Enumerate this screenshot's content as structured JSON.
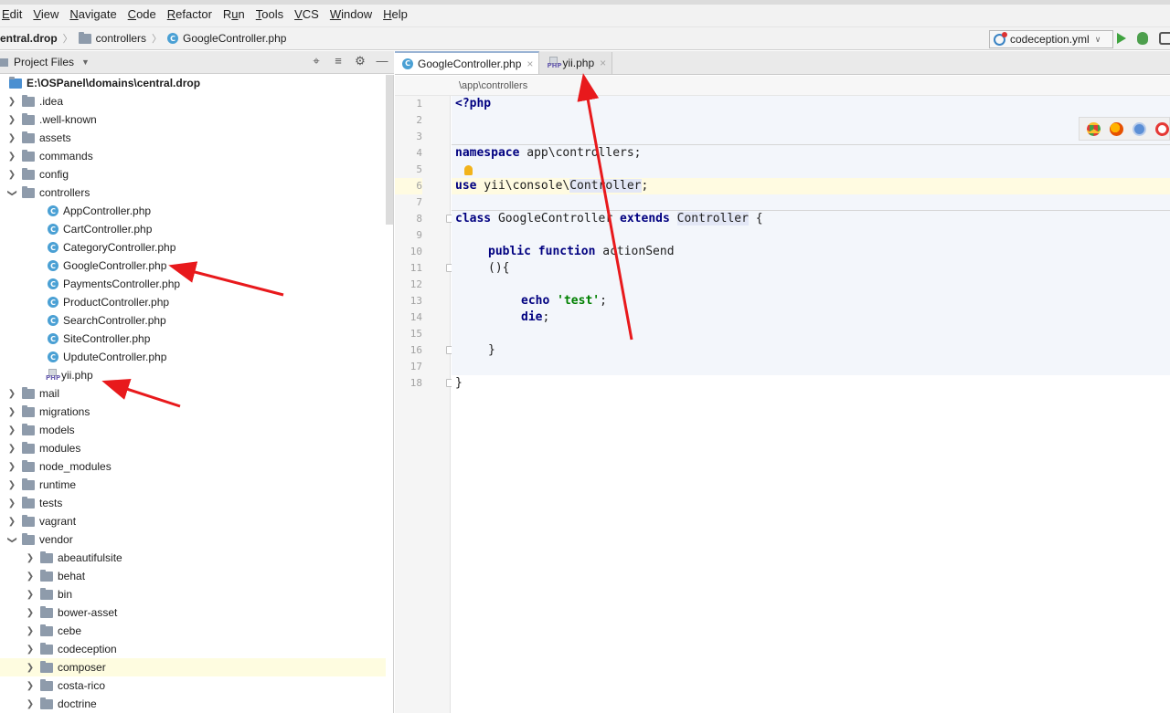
{
  "menu": [
    "Edit",
    "View",
    "Navigate",
    "Code",
    "Refactor",
    "Run",
    "Tools",
    "VCS",
    "Window",
    "Help"
  ],
  "menu_underline": [
    "E",
    "V",
    "N",
    "C",
    "R",
    "u",
    "T",
    "V",
    "W",
    "H"
  ],
  "breadcrumb": {
    "project": "entral.drop",
    "folder": "controllers",
    "file": "GoogleController.php"
  },
  "run_config": "codeception.yml",
  "project_panel": {
    "title": "Project Files"
  },
  "tree": [
    {
      "label": "E:\\OSPanel\\domains\\central.drop",
      "type": "root"
    },
    {
      "label": ".idea",
      "type": "folder",
      "depth": 1,
      "expanded": false
    },
    {
      "label": ".well-known",
      "type": "folder",
      "depth": 1,
      "expanded": false
    },
    {
      "label": "assets",
      "type": "folder",
      "depth": 1,
      "expanded": false
    },
    {
      "label": "commands",
      "type": "folder",
      "depth": 1,
      "expanded": false
    },
    {
      "label": "config",
      "type": "folder",
      "depth": 1,
      "expanded": false
    },
    {
      "label": "controllers",
      "type": "folder",
      "depth": 1,
      "expanded": true
    },
    {
      "label": "AppController.php",
      "type": "class",
      "depth": 2
    },
    {
      "label": "CartController.php",
      "type": "class",
      "depth": 2
    },
    {
      "label": "CategoryController.php",
      "type": "class",
      "depth": 2
    },
    {
      "label": "GoogleController.php",
      "type": "class",
      "depth": 2
    },
    {
      "label": "PaymentsController.php",
      "type": "class",
      "depth": 2
    },
    {
      "label": "ProductController.php",
      "type": "class",
      "depth": 2
    },
    {
      "label": "SearchController.php",
      "type": "class",
      "depth": 2
    },
    {
      "label": "SiteController.php",
      "type": "class",
      "depth": 2
    },
    {
      "label": "UpduteController.php",
      "type": "class",
      "depth": 2
    },
    {
      "label": "yii.php",
      "type": "php",
      "depth": 2
    },
    {
      "label": "mail",
      "type": "folder",
      "depth": 1,
      "expanded": false
    },
    {
      "label": "migrations",
      "type": "folder",
      "depth": 1,
      "expanded": false
    },
    {
      "label": "models",
      "type": "folder",
      "depth": 1,
      "expanded": false
    },
    {
      "label": "modules",
      "type": "folder",
      "depth": 1,
      "expanded": false
    },
    {
      "label": "node_modules",
      "type": "folder",
      "depth": 1,
      "expanded": false
    },
    {
      "label": "runtime",
      "type": "folder",
      "depth": 1,
      "expanded": false
    },
    {
      "label": "tests",
      "type": "folder",
      "depth": 1,
      "expanded": false
    },
    {
      "label": "vagrant",
      "type": "folder",
      "depth": 1,
      "expanded": false
    },
    {
      "label": "vendor",
      "type": "folder",
      "depth": 1,
      "expanded": true
    },
    {
      "label": "abeautifulsite",
      "type": "folder",
      "depth": 2,
      "expanded": false
    },
    {
      "label": "behat",
      "type": "folder",
      "depth": 2,
      "expanded": false
    },
    {
      "label": "bin",
      "type": "folder",
      "depth": 2,
      "expanded": false
    },
    {
      "label": "bower-asset",
      "type": "folder",
      "depth": 2,
      "expanded": false
    },
    {
      "label": "cebe",
      "type": "folder",
      "depth": 2,
      "expanded": false
    },
    {
      "label": "codeception",
      "type": "folder",
      "depth": 2,
      "expanded": false
    },
    {
      "label": "composer",
      "type": "folder",
      "depth": 2,
      "expanded": false,
      "highlight": true
    },
    {
      "label": "costa-rico",
      "type": "folder",
      "depth": 2,
      "expanded": false
    },
    {
      "label": "doctrine",
      "type": "folder",
      "depth": 2,
      "expanded": false
    }
  ],
  "tabs": [
    {
      "label": "GoogleController.php",
      "type": "class",
      "active": true
    },
    {
      "label": "yii.php",
      "type": "php",
      "active": false
    }
  ],
  "editor_breadcrumb": "\\app\\controllers",
  "code": {
    "line_numbers": [
      "1",
      "2",
      "3",
      "4",
      "5",
      "6",
      "7",
      "8",
      "9",
      "10",
      "11",
      "12",
      "13",
      "14",
      "15",
      "16",
      "17",
      "18"
    ],
    "l1": "<?php",
    "ns_kw": "namespace",
    "ns_rest": " app\\controllers;",
    "use_kw": "use",
    "use_mid": " yii\\console\\",
    "use_ref": "Controller",
    "use_end": ";",
    "class_kw": "class",
    "class_name": " GoogleController ",
    "extends_kw": "extends",
    "class_ref": "Controller",
    "class_end": " {",
    "pub_kw": "public",
    "fn_kw": "function",
    "fn_name": " actionSend",
    "paren": "(){",
    "echo_kw": "echo",
    "echo_str": "'test'",
    "semi": ";",
    "die_kw": "die",
    "close_inner": "}",
    "close_outer": "}"
  },
  "colors": {
    "keyword": "#000080",
    "string": "#008000",
    "annotation_arrow": "#e8191c",
    "class_icon": "#4aa0d4",
    "current_line": "#fffbe1"
  }
}
